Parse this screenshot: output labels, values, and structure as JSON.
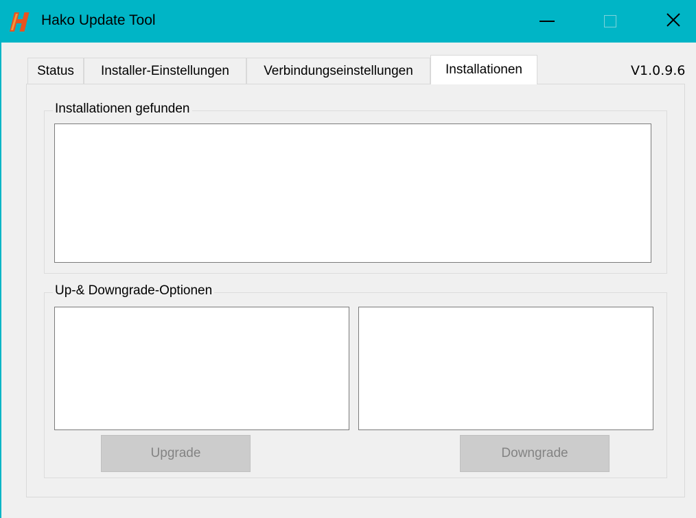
{
  "window": {
    "title": "Hako Update Tool",
    "icon": "hako-logo-icon",
    "titlebar_color": "#00b5c6",
    "accent_icon_color": "#e8531f"
  },
  "tabs": [
    {
      "label": "Status",
      "active": false
    },
    {
      "label": "Installer-Einstellungen",
      "active": false
    },
    {
      "label": "Verbindungseinstellungen",
      "active": false
    },
    {
      "label": "Installationen",
      "active": true
    }
  ],
  "version": "V1.0.9.6",
  "installations_group": {
    "label": "Installationen gefunden",
    "items": []
  },
  "options_group": {
    "label": "Up-& Downgrade-Optionen",
    "upgrade_items": [],
    "downgrade_items": [],
    "upgrade_button": "Upgrade",
    "downgrade_button": "Downgrade",
    "buttons_enabled": false
  }
}
